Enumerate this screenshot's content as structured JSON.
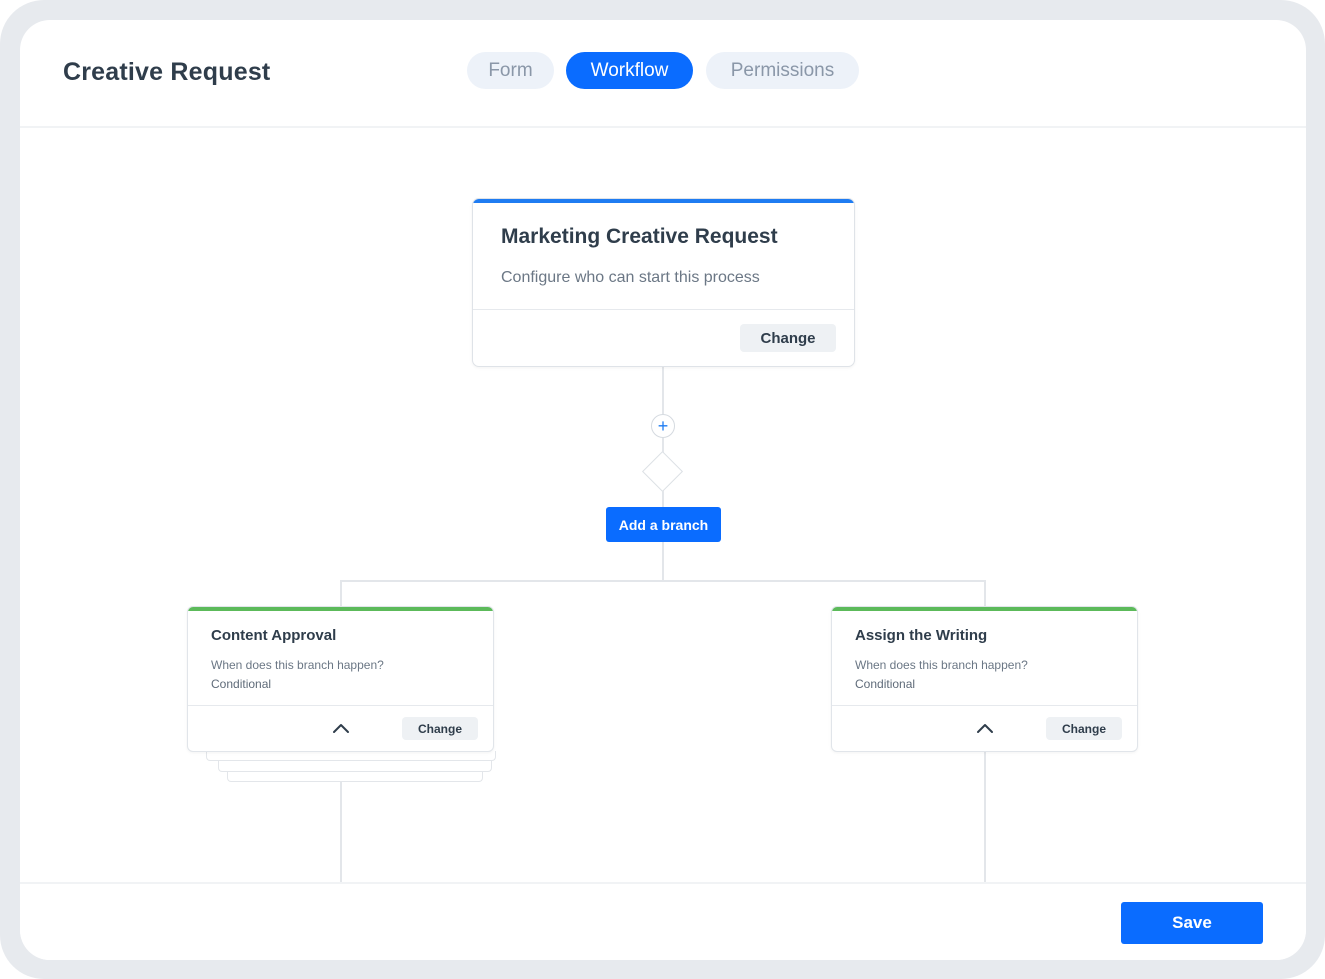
{
  "header": {
    "title": "Creative Request",
    "tabs": [
      {
        "label": "Form"
      },
      {
        "label": "Workflow"
      },
      {
        "label": "Permissions"
      }
    ],
    "active_tab": "Workflow"
  },
  "workflow": {
    "start": {
      "title": "Marketing Creative Request",
      "subtitle": "Configure who can start this process",
      "change_label": "Change"
    },
    "add_step_icon": "plus-icon",
    "add_branch_label": "Add a branch",
    "branches": [
      {
        "title": "Content Approval",
        "question": "When does this branch happen?",
        "condition": "Conditional",
        "change_label": "Change",
        "toggle_icon": "chevron-up-icon"
      },
      {
        "title": "Assign the Writing",
        "question": "When does this branch happen?",
        "condition": "Conditional",
        "change_label": "Change",
        "toggle_icon": "chevron-up-icon"
      }
    ]
  },
  "footer": {
    "save_label": "Save"
  },
  "colors": {
    "primary": "#0a6cff",
    "start_accent": "#1f7cf2",
    "branch_accent": "#5cba5a",
    "tab_inactive_bg": "#edf2f9"
  }
}
